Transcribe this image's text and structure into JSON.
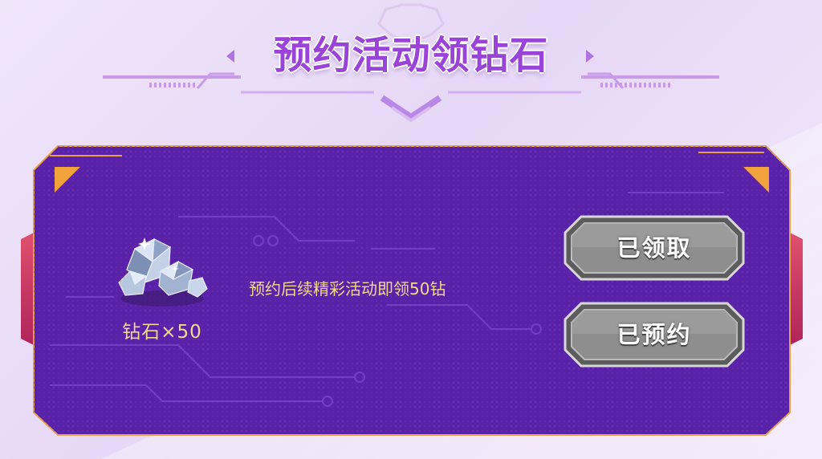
{
  "header": {
    "title": "预约活动领钻石"
  },
  "reward": {
    "icon": "diamond-pile-icon",
    "label": "钻石×50"
  },
  "description": "预约后续精彩活动即领50钻",
  "buttons": {
    "claimed_label": "已领取",
    "reserved_label": "已预约"
  },
  "colors": {
    "panel": "#5a22a8",
    "accent_orange": "#f2a23a",
    "title": "#9a43d8",
    "gold_text": "#f4d98a",
    "button_gray": "#8a8a8a"
  }
}
